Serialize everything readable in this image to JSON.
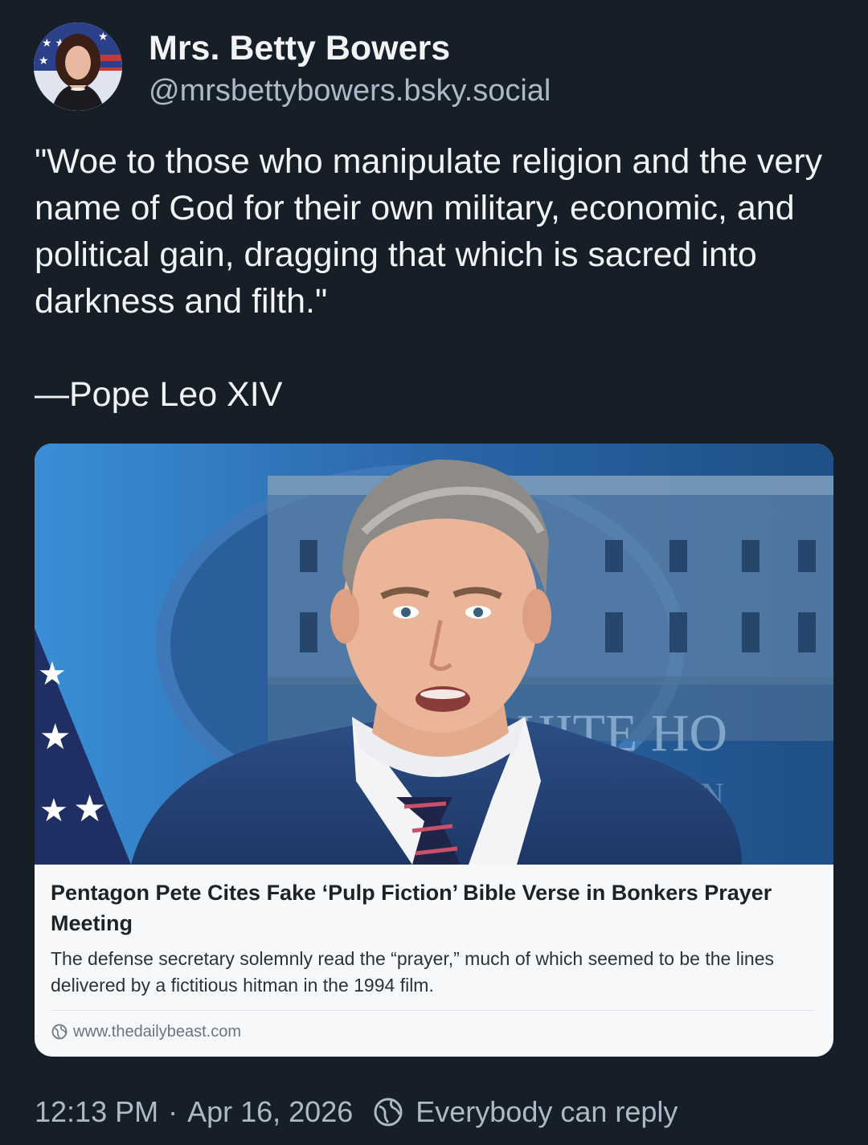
{
  "author": {
    "display_name": "Mrs. Betty Bowers",
    "handle": "@mrsbettybowers.bsky.social"
  },
  "post": {
    "text": "\"Woe to those who manipulate religion and the very name of God for their own military, economic, and political gain, dragging that which is sacred into darkness and filth.\"",
    "attribution": "—Pope Leo XIV"
  },
  "link_card": {
    "image_signage": "HITE HO",
    "image_signage_sub": "ON",
    "title": "Pentagon Pete Cites Fake ‘Pulp Fiction’ Bible Verse in Bonkers Prayer Meeting",
    "description": "The defense secretary solemnly read the “prayer,” much of which seemed to be the lines delivered by a fictitious hitman in the 1994 film.",
    "domain": "www.thedailybeast.com",
    "domain_icon": "globe-icon"
  },
  "footer": {
    "timestamp": "12:13 PM",
    "separator": "·",
    "date": "Apr 16, 2026",
    "reply_setting": "Everybody can reply",
    "reply_icon": "globe-icon"
  },
  "colors": {
    "background": "#161e27",
    "text_primary": "#f1f3f5",
    "text_secondary": "#aeb9c8",
    "card_background": "#f7f8fa"
  }
}
